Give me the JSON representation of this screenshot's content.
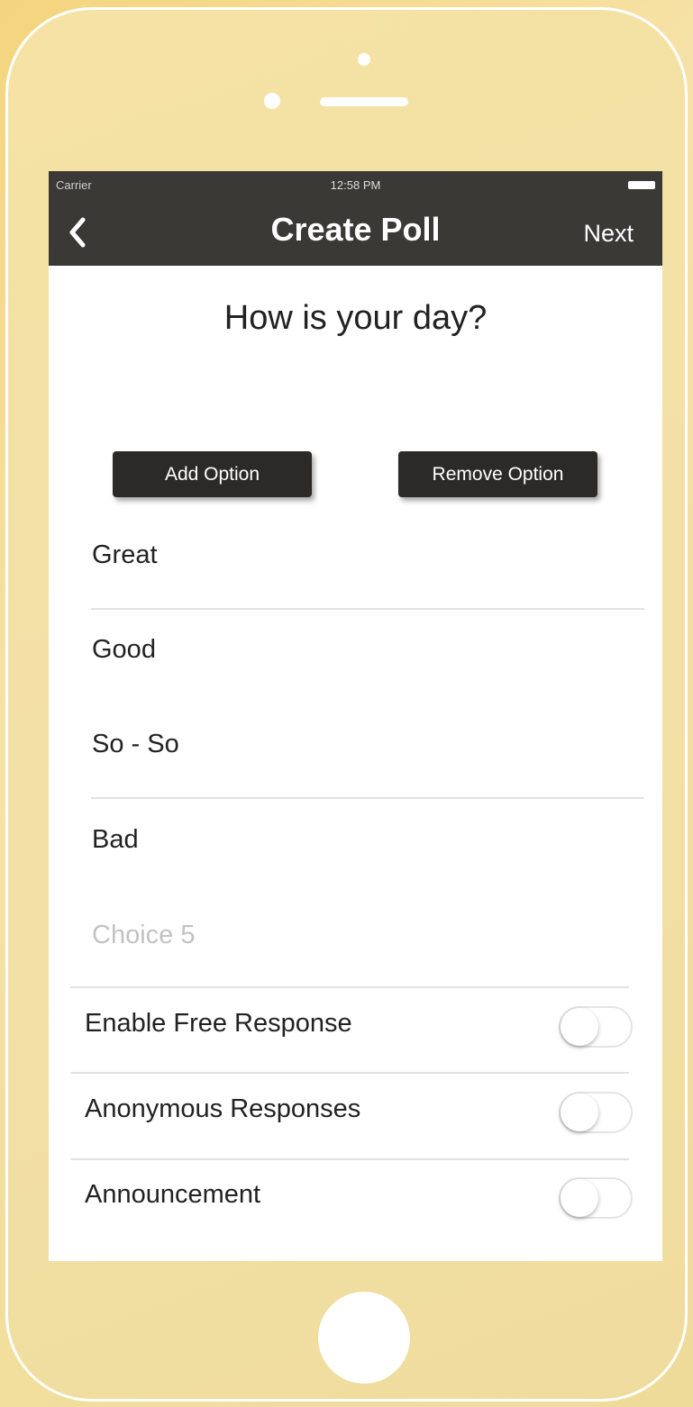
{
  "status_bar": {
    "carrier": "Carrier",
    "time": "12:58 PM"
  },
  "navbar": {
    "title": "Create Poll",
    "next_label": "Next"
  },
  "poll": {
    "question": "How is your day?",
    "add_option_label": "Add Option",
    "remove_option_label": "Remove Option",
    "options": [
      {
        "value": "Great"
      },
      {
        "value": "Good"
      },
      {
        "value": "So - So"
      },
      {
        "value": "Bad"
      },
      {
        "placeholder": "Choice 5"
      }
    ]
  },
  "settings": [
    {
      "label": "Enable Free Response",
      "enabled": false
    },
    {
      "label": "Anonymous Responses",
      "enabled": false
    },
    {
      "label": "Announcement",
      "enabled": false
    }
  ],
  "colors": {
    "background": "#f4d57e",
    "navbar": "#3a3936",
    "button": "#2b2a28",
    "placeholder": "#c2c2c2"
  }
}
